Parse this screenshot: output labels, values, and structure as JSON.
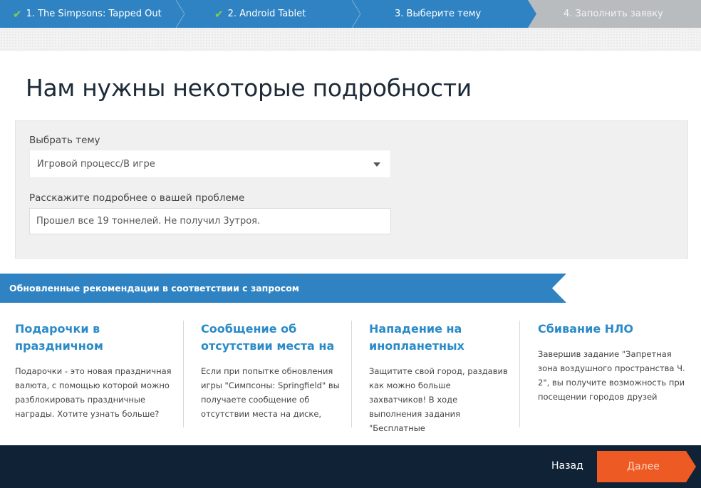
{
  "steps": [
    {
      "label": "1. The Simpsons: Tapped Out",
      "done": true
    },
    {
      "label": "2. Android Tablet",
      "done": true
    },
    {
      "label": "3. Выберите тему",
      "done": false
    },
    {
      "label": "4. Заполнить заявку",
      "done": false
    }
  ],
  "colors": {
    "step_active": "#2f83c3",
    "step_inactive": "#b9bcbf",
    "check": "#7fd14b",
    "accent": "#2a8bc8",
    "footer": "#0f2236",
    "next": "#ee5a24"
  },
  "page_title": "Нам нужны некоторые подробности",
  "form": {
    "topic_label": "Выбрать тему",
    "topic_value": "Игровой процесс/В игре",
    "details_label": "Расскажите подробнее о вашей проблеме",
    "details_value": "Прошел все 19 тоннелей. Не получил 3утроя."
  },
  "recommendations": {
    "heading": "Обновленные рекомендации в соответствии с запросом",
    "cards": [
      {
        "title": "Подарочки в праздничном",
        "body": "Подарочки - это новая праздничная валюта, с помощью которой можно разблокировать праздничные награды. Хотите узнать больше?"
      },
      {
        "title": "Сообщение об отсутствии места на",
        "body": "Если при попытке обновления игры \"Симпсоны: Springfield\" вы получаете сообщение об отсутствии места на диске,"
      },
      {
        "title": "Нападение на инопланетных",
        "body": "Защитите свой город, раздавив как можно больше захватчиков! В ходе выполнения задания \"Бесплатные"
      },
      {
        "title": "Сбивание НЛО",
        "body": "Завершив задание \"Запретная зона воздушного пространства Ч. 2\", вы получите возможность при посещении городов друзей"
      }
    ]
  },
  "footer": {
    "back_label": "Назад",
    "next_label": "Далее"
  },
  "icons": {
    "check": "check-icon",
    "dropdown": "chevron-down-icon"
  }
}
